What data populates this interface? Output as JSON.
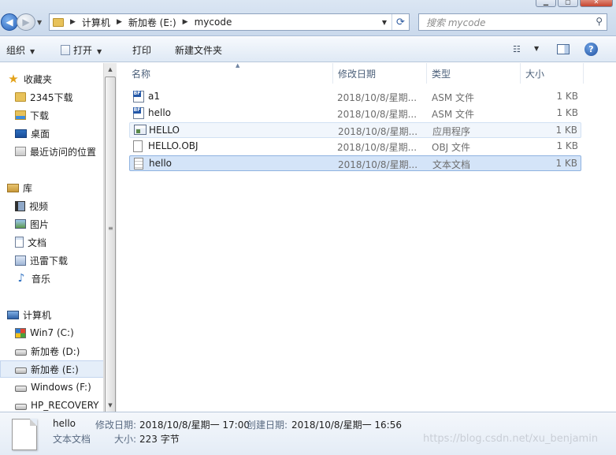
{
  "window": {
    "controls": [
      "minimize",
      "maximize",
      "close"
    ]
  },
  "address_bar": {
    "breadcrumbs": [
      "计算机",
      "新加卷 (E:)",
      "mycode"
    ]
  },
  "search": {
    "placeholder": "搜索 mycode"
  },
  "toolbar": {
    "organize": "组织",
    "open": "打开",
    "print": "打印",
    "new_folder": "新建文件夹"
  },
  "navigation": {
    "favorites": {
      "title": "收藏夹",
      "items": [
        "2345下载",
        "下载",
        "桌面",
        "最近访问的位置"
      ]
    },
    "libraries": {
      "title": "库",
      "items": [
        "视频",
        "图片",
        "文档",
        "迅雷下载",
        "音乐"
      ]
    },
    "computer": {
      "title": "计算机",
      "items": [
        "Win7 (C:)",
        "新加卷 (D:)",
        "新加卷 (E:)",
        "Windows  (F:)",
        "HP_RECOVERY"
      ]
    }
  },
  "columns": {
    "name": "名称",
    "date": "修改日期",
    "type": "类型",
    "size": "大小"
  },
  "files": [
    {
      "name": "a1",
      "date": "2018/10/8/星期...",
      "type": "ASM 文件",
      "size": "1 KB",
      "icon": "asm-file-icon"
    },
    {
      "name": "hello",
      "date": "2018/10/8/星期...",
      "type": "ASM 文件",
      "size": "1 KB",
      "icon": "asm-file-icon"
    },
    {
      "name": "HELLO",
      "date": "2018/10/8/星期...",
      "type": "应用程序",
      "size": "1 KB",
      "icon": "exe-file-icon"
    },
    {
      "name": "HELLO.OBJ",
      "date": "2018/10/8/星期...",
      "type": "OBJ 文件",
      "size": "1 KB",
      "icon": "obj-file-icon"
    },
    {
      "name": "hello",
      "date": "2018/10/8/星期...",
      "type": "文本文档",
      "size": "1 KB",
      "icon": "text-file-icon"
    }
  ],
  "details": {
    "name": "hello",
    "type": "文本文档",
    "modified_label": "修改日期:",
    "modified_value": "2018/10/8/星期一 17:00",
    "created_label": "创建日期:",
    "created_value": "2018/10/8/星期一 16:56",
    "size_label": "大小:",
    "size_value": "223 字节"
  },
  "watermark": "https://blog.csdn.net/xu_benjamin"
}
